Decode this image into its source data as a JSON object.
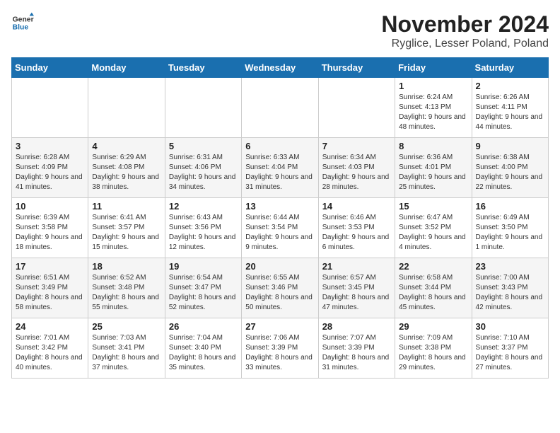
{
  "logo": {
    "general": "General",
    "blue": "Blue"
  },
  "title": "November 2024",
  "location": "Ryglice, Lesser Poland, Poland",
  "days_of_week": [
    "Sunday",
    "Monday",
    "Tuesday",
    "Wednesday",
    "Thursday",
    "Friday",
    "Saturday"
  ],
  "weeks": [
    [
      {
        "day": "",
        "info": ""
      },
      {
        "day": "",
        "info": ""
      },
      {
        "day": "",
        "info": ""
      },
      {
        "day": "",
        "info": ""
      },
      {
        "day": "",
        "info": ""
      },
      {
        "day": "1",
        "info": "Sunrise: 6:24 AM\nSunset: 4:13 PM\nDaylight: 9 hours and 48 minutes."
      },
      {
        "day": "2",
        "info": "Sunrise: 6:26 AM\nSunset: 4:11 PM\nDaylight: 9 hours and 44 minutes."
      }
    ],
    [
      {
        "day": "3",
        "info": "Sunrise: 6:28 AM\nSunset: 4:09 PM\nDaylight: 9 hours and 41 minutes."
      },
      {
        "day": "4",
        "info": "Sunrise: 6:29 AM\nSunset: 4:08 PM\nDaylight: 9 hours and 38 minutes."
      },
      {
        "day": "5",
        "info": "Sunrise: 6:31 AM\nSunset: 4:06 PM\nDaylight: 9 hours and 34 minutes."
      },
      {
        "day": "6",
        "info": "Sunrise: 6:33 AM\nSunset: 4:04 PM\nDaylight: 9 hours and 31 minutes."
      },
      {
        "day": "7",
        "info": "Sunrise: 6:34 AM\nSunset: 4:03 PM\nDaylight: 9 hours and 28 minutes."
      },
      {
        "day": "8",
        "info": "Sunrise: 6:36 AM\nSunset: 4:01 PM\nDaylight: 9 hours and 25 minutes."
      },
      {
        "day": "9",
        "info": "Sunrise: 6:38 AM\nSunset: 4:00 PM\nDaylight: 9 hours and 22 minutes."
      }
    ],
    [
      {
        "day": "10",
        "info": "Sunrise: 6:39 AM\nSunset: 3:58 PM\nDaylight: 9 hours and 18 minutes."
      },
      {
        "day": "11",
        "info": "Sunrise: 6:41 AM\nSunset: 3:57 PM\nDaylight: 9 hours and 15 minutes."
      },
      {
        "day": "12",
        "info": "Sunrise: 6:43 AM\nSunset: 3:56 PM\nDaylight: 9 hours and 12 minutes."
      },
      {
        "day": "13",
        "info": "Sunrise: 6:44 AM\nSunset: 3:54 PM\nDaylight: 9 hours and 9 minutes."
      },
      {
        "day": "14",
        "info": "Sunrise: 6:46 AM\nSunset: 3:53 PM\nDaylight: 9 hours and 6 minutes."
      },
      {
        "day": "15",
        "info": "Sunrise: 6:47 AM\nSunset: 3:52 PM\nDaylight: 9 hours and 4 minutes."
      },
      {
        "day": "16",
        "info": "Sunrise: 6:49 AM\nSunset: 3:50 PM\nDaylight: 9 hours and 1 minute."
      }
    ],
    [
      {
        "day": "17",
        "info": "Sunrise: 6:51 AM\nSunset: 3:49 PM\nDaylight: 8 hours and 58 minutes."
      },
      {
        "day": "18",
        "info": "Sunrise: 6:52 AM\nSunset: 3:48 PM\nDaylight: 8 hours and 55 minutes."
      },
      {
        "day": "19",
        "info": "Sunrise: 6:54 AM\nSunset: 3:47 PM\nDaylight: 8 hours and 52 minutes."
      },
      {
        "day": "20",
        "info": "Sunrise: 6:55 AM\nSunset: 3:46 PM\nDaylight: 8 hours and 50 minutes."
      },
      {
        "day": "21",
        "info": "Sunrise: 6:57 AM\nSunset: 3:45 PM\nDaylight: 8 hours and 47 minutes."
      },
      {
        "day": "22",
        "info": "Sunrise: 6:58 AM\nSunset: 3:44 PM\nDaylight: 8 hours and 45 minutes."
      },
      {
        "day": "23",
        "info": "Sunrise: 7:00 AM\nSunset: 3:43 PM\nDaylight: 8 hours and 42 minutes."
      }
    ],
    [
      {
        "day": "24",
        "info": "Sunrise: 7:01 AM\nSunset: 3:42 PM\nDaylight: 8 hours and 40 minutes."
      },
      {
        "day": "25",
        "info": "Sunrise: 7:03 AM\nSunset: 3:41 PM\nDaylight: 8 hours and 37 minutes."
      },
      {
        "day": "26",
        "info": "Sunrise: 7:04 AM\nSunset: 3:40 PM\nDaylight: 8 hours and 35 minutes."
      },
      {
        "day": "27",
        "info": "Sunrise: 7:06 AM\nSunset: 3:39 PM\nDaylight: 8 hours and 33 minutes."
      },
      {
        "day": "28",
        "info": "Sunrise: 7:07 AM\nSunset: 3:39 PM\nDaylight: 8 hours and 31 minutes."
      },
      {
        "day": "29",
        "info": "Sunrise: 7:09 AM\nSunset: 3:38 PM\nDaylight: 8 hours and 29 minutes."
      },
      {
        "day": "30",
        "info": "Sunrise: 7:10 AM\nSunset: 3:37 PM\nDaylight: 8 hours and 27 minutes."
      }
    ]
  ]
}
